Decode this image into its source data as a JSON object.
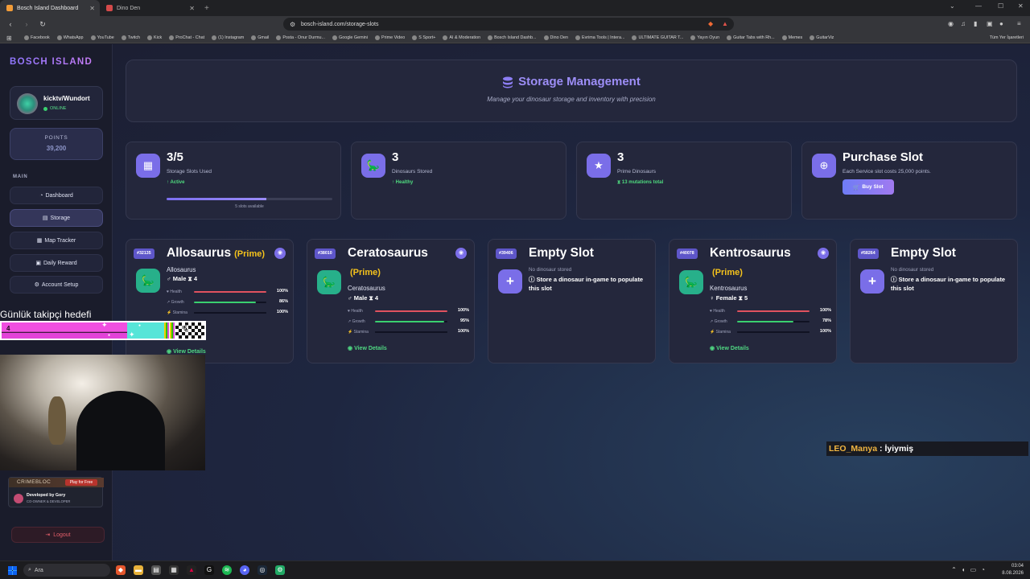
{
  "browser": {
    "tabs": [
      {
        "title": "Bosch Island Dashboard"
      },
      {
        "title": "Dino Den"
      }
    ],
    "new_tab": "+",
    "url": "bosch-island.com/storage-slots",
    "bookmarks": [
      "Facebook",
      "WhatsApp",
      "YouTube",
      "Twitch",
      "Kick",
      "ProChat - Chat",
      "(1) Instagram",
      "Gmail",
      "Posta - Onur Durmu...",
      "Google Gemini",
      "Prime Video",
      "S Sport+",
      "AI & Moderation",
      "Bosch Island Dashb...",
      "Dino Den",
      "Evrima Tools | Intera...",
      "ULTIMATE GUITAR T...",
      "Yayın Oyun",
      "Guitar Tabs with Rh...",
      "Memes",
      "GuitarViz"
    ],
    "other_bookmarks": "Tüm Yer İşaretleri"
  },
  "sidebar": {
    "logo": "BOSCH ISLAND",
    "user": {
      "name": "kicktv/Wundort",
      "status": "ONLINE"
    },
    "points": {
      "label": "POINTS",
      "value": "39,200"
    },
    "section_label": "MAIN",
    "nav": [
      {
        "label": "Dashboard",
        "icon": "dashboard-icon"
      },
      {
        "label": "Storage",
        "icon": "storage-icon",
        "active": true
      },
      {
        "label": "Map Tracker",
        "icon": "map-icon"
      },
      {
        "label": "Daily Reward",
        "icon": "gift-icon"
      },
      {
        "label": "Account Setup",
        "icon": "user-gear-icon"
      }
    ],
    "promo": {
      "title": "CRIMEBLOC",
      "cta": "Play for Free",
      "developed_by": "Developed by Gory",
      "role": "CO-OWNER & DEVELOPER"
    },
    "logout": "Logout"
  },
  "header": {
    "title": "Storage Management",
    "subtitle": "Manage your dinosaur storage and inventory with precision"
  },
  "stats": [
    {
      "value": "3/5",
      "label": "Storage Slots Used",
      "status": "Active",
      "progress": 0.6,
      "footnote": "5 slots available"
    },
    {
      "value": "3",
      "label": "Dinosaurs Stored",
      "status": "Healthy"
    },
    {
      "value": "3",
      "label": "Prime Dinosaurs",
      "status": "13 mutations total"
    },
    {
      "value": "Purchase Slot",
      "label": "Each Service slot costs 25,000 points.",
      "button": "Buy Slot"
    }
  ],
  "slots": [
    {
      "id": "#32135",
      "name": "Allosaurus",
      "prime": "(Prime)",
      "species": "Allosaurus",
      "gender": "Male",
      "mutations": "4",
      "stats": [
        {
          "label": "Health",
          "value": "100%",
          "pct": 100
        },
        {
          "label": "Growth",
          "value": "86%",
          "pct": 86
        },
        {
          "label": "Stamina",
          "value": "100%",
          "pct": 100
        }
      ],
      "view": "View Details"
    },
    {
      "id": "#38010",
      "name": "Ceratosaurus",
      "prime": "(Prime)",
      "species": "Ceratosaurus",
      "gender": "Male",
      "mutations": "4",
      "stats": [
        {
          "label": "Health",
          "value": "100%",
          "pct": 100
        },
        {
          "label": "Growth",
          "value": "95%",
          "pct": 95
        },
        {
          "label": "Stamina",
          "value": "100%",
          "pct": 100
        }
      ],
      "view": "View Details"
    },
    {
      "id": "#39406",
      "name": "Empty Slot",
      "empty_sub": "No dinosaur stored",
      "empty_msg": "Store a dinosaur in-game to populate this slot"
    },
    {
      "id": "#40078",
      "name": "Kentrosaurus",
      "prime": "(Prime)",
      "species": "Kentrosaurus",
      "gender": "Female",
      "mutations": "5",
      "stats": [
        {
          "label": "Health",
          "value": "100%",
          "pct": 100
        },
        {
          "label": "Growth",
          "value": "78%",
          "pct": 78
        },
        {
          "label": "Stamina",
          "value": "100%",
          "pct": 100
        }
      ],
      "view": "View Details"
    },
    {
      "id": "#58264",
      "name": "Empty Slot",
      "empty_sub": "No dinosaur stored",
      "empty_msg": "Store a dinosaur in-game to populate this slot"
    }
  ],
  "overlay": {
    "goal_text": "Günlük takipçi hedefi",
    "goal_current": "4",
    "goal_target": "5",
    "goal_progress": 0.8,
    "chat_user": "LEO_Manya",
    "chat_sep": ":",
    "chat_text": "İyiymiş"
  },
  "taskbar": {
    "search": "Ara",
    "time": "03:04",
    "date": "8.08.2026"
  },
  "colors": {
    "accent": "#7a6ee8",
    "success": "#4fdb7f",
    "prime": "#f4c21c",
    "health": "#e0525f",
    "growth": "#3ad06f",
    "stamina": "#101222",
    "danger": "#e35e6a"
  }
}
